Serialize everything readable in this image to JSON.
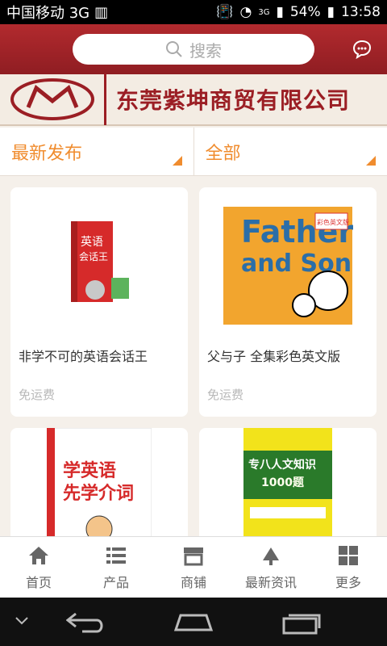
{
  "status_bar": {
    "carrier": "中国移动 3G",
    "network": "3G",
    "battery": "54%",
    "time": "13:58"
  },
  "header": {
    "search_placeholder": "搜索"
  },
  "banner": {
    "company_name": "东莞紫坤商贸有限公司"
  },
  "filters": [
    {
      "label": "最新发布"
    },
    {
      "label": "全部"
    }
  ],
  "products": [
    {
      "title": "非学不可的英语会话王",
      "shipping": "免运费",
      "cover_text_1": "英语",
      "cover_text_2": "会话王"
    },
    {
      "title": "父与子 全集彩色英文版",
      "shipping": "免运费",
      "cover_text_1": "Father",
      "cover_text_2": "and Son",
      "cover_badge": "彩色英文版"
    },
    {
      "title": "",
      "shipping": "",
      "cover_text_1": "学英语",
      "cover_text_2": "先学介词"
    },
    {
      "title": "",
      "shipping": "",
      "cover_text_1": "专八人文知识",
      "cover_text_2": "1000题"
    }
  ],
  "tabbar": [
    {
      "label": "首页",
      "icon": "home-icon"
    },
    {
      "label": "产品",
      "icon": "list-icon"
    },
    {
      "label": "商铺",
      "icon": "store-icon"
    },
    {
      "label": "最新资讯",
      "icon": "news-icon"
    },
    {
      "label": "更多",
      "icon": "grid-icon"
    }
  ],
  "colors": {
    "header": "#a3252a",
    "accent": "#f08c2e",
    "banner_text": "#9b1e24"
  }
}
